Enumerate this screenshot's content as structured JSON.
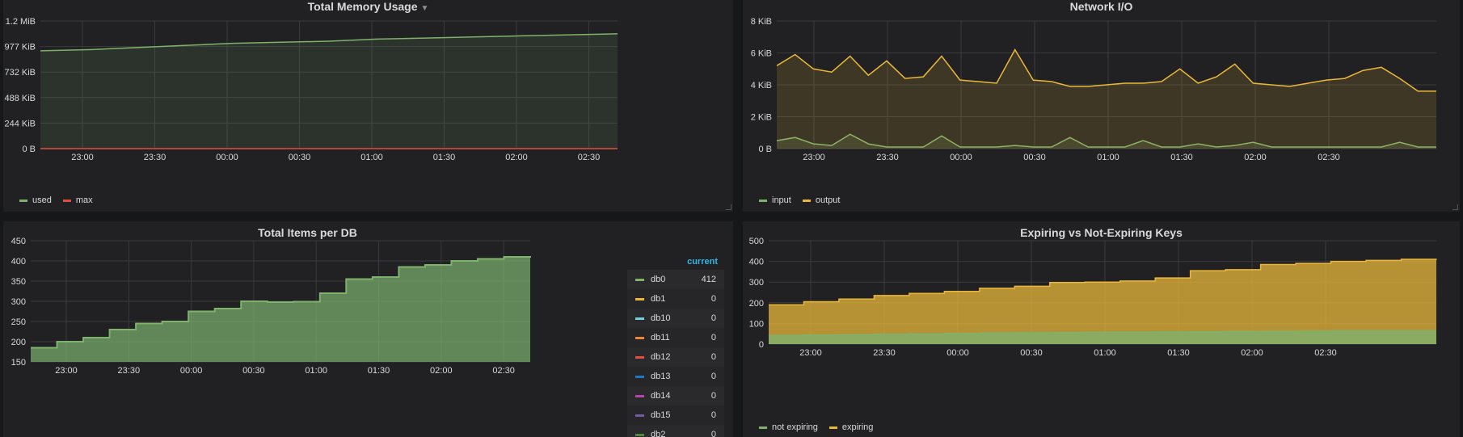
{
  "panels": {
    "memory": {
      "title": "Total Memory Usage",
      "legend": [
        {
          "label": "used",
          "color": "#7eb26d"
        },
        {
          "label": "max",
          "color": "#e24d42"
        }
      ]
    },
    "network": {
      "title": "Network I/O",
      "legend": [
        {
          "label": "input",
          "color": "#7eb26d"
        },
        {
          "label": "output",
          "color": "#eab839"
        }
      ]
    },
    "items": {
      "title": "Total Items per DB",
      "legend_header": "current",
      "legend": [
        {
          "label": "db0",
          "value": "412",
          "color": "#7eb26d"
        },
        {
          "label": "db1",
          "value": "0",
          "color": "#eab839"
        },
        {
          "label": "db10",
          "value": "0",
          "color": "#6ed0e0"
        },
        {
          "label": "db11",
          "value": "0",
          "color": "#ef843c"
        },
        {
          "label": "db12",
          "value": "0",
          "color": "#e24d42"
        },
        {
          "label": "db13",
          "value": "0",
          "color": "#1f78c1"
        },
        {
          "label": "db14",
          "value": "0",
          "color": "#ba43a9"
        },
        {
          "label": "db15",
          "value": "0",
          "color": "#705da0"
        },
        {
          "label": "db2",
          "value": "0",
          "color": "#508642"
        }
      ]
    },
    "expiring": {
      "title": "Expiring vs Not-Expiring Keys",
      "legend": [
        {
          "label": "not expiring",
          "color": "#7eb26d"
        },
        {
          "label": "expiring",
          "color": "#eab839"
        }
      ]
    }
  },
  "chart_data": [
    {
      "type": "line",
      "title": "Total Memory Usage",
      "x_ticks": [
        "23:00",
        "23:30",
        "00:00",
        "00:30",
        "01:00",
        "01:30",
        "02:00",
        "02:30"
      ],
      "y_ticks": [
        "0 B",
        "244 KiB",
        "488 KiB",
        "732 KiB",
        "977 KiB",
        "1.2 MiB"
      ],
      "ylim": [
        0,
        1.2
      ],
      "y_unit": "MiB",
      "series": [
        {
          "name": "used",
          "values": [
            0.92,
            0.93,
            0.95,
            0.97,
            0.99,
            1.0,
            1.01,
            1.03,
            1.04,
            1.05,
            1.06,
            1.07,
            1.08
          ]
        },
        {
          "name": "max",
          "values": [
            0,
            0,
            0,
            0,
            0,
            0,
            0,
            0,
            0,
            0,
            0,
            0,
            0
          ]
        }
      ]
    },
    {
      "type": "area",
      "title": "Network I/O",
      "x_ticks": [
        "23:00",
        "23:30",
        "00:00",
        "00:30",
        "01:00",
        "01:30",
        "02:00",
        "02:30"
      ],
      "y_ticks": [
        "0 B",
        "2 KiB",
        "4 KiB",
        "6 KiB",
        "8 KiB"
      ],
      "ylim": [
        0,
        8
      ],
      "y_unit": "KiB",
      "series": [
        {
          "name": "input",
          "values": [
            0.5,
            0.7,
            0.3,
            0.2,
            0.9,
            0.3,
            0.1,
            0.1,
            0.1,
            0.8,
            0.1,
            0.1,
            0.1,
            0.2,
            0.1,
            0.1,
            0.7,
            0.1,
            0.1,
            0.1,
            0.5,
            0.1,
            0.1,
            0.3,
            0.1,
            0.2,
            0.4,
            0.1,
            0.1,
            0.1,
            0.1,
            0.1,
            0.1,
            0.1,
            0.4,
            0.1,
            0.1
          ]
        },
        {
          "name": "output",
          "values": [
            5.2,
            5.9,
            5.0,
            4.8,
            5.8,
            4.6,
            5.5,
            4.4,
            4.5,
            5.8,
            4.3,
            4.2,
            4.1,
            6.2,
            4.3,
            4.2,
            3.9,
            3.9,
            4.0,
            4.1,
            4.1,
            4.2,
            5.0,
            4.1,
            4.5,
            5.3,
            4.1,
            4.0,
            3.9,
            4.1,
            4.3,
            4.4,
            4.9,
            5.1,
            4.4,
            3.6,
            3.6
          ]
        }
      ]
    },
    {
      "type": "area",
      "title": "Total Items per DB",
      "x_ticks": [
        "23:00",
        "23:30",
        "00:00",
        "00:30",
        "01:00",
        "01:30",
        "02:00",
        "02:30"
      ],
      "y_ticks": [
        "150",
        "200",
        "250",
        "300",
        "350",
        "400",
        "450"
      ],
      "ylim": [
        150,
        450
      ],
      "series": [
        {
          "name": "db0",
          "values": [
            185,
            200,
            210,
            230,
            245,
            250,
            275,
            282,
            300,
            298,
            299,
            320,
            355,
            360,
            385,
            390,
            400,
            405,
            410,
            412
          ]
        }
      ]
    },
    {
      "type": "area",
      "title": "Expiring vs Not-Expiring Keys",
      "x_ticks": [
        "23:00",
        "23:30",
        "00:00",
        "00:30",
        "01:00",
        "01:30",
        "02:00",
        "02:30"
      ],
      "y_ticks": [
        "0",
        "100",
        "200",
        "300",
        "400",
        "500"
      ],
      "ylim": [
        0,
        500
      ],
      "series": [
        {
          "name": "not expiring",
          "values": [
            42,
            44,
            46,
            48,
            50,
            52,
            54,
            55,
            56,
            57,
            58,
            59,
            60,
            61,
            62,
            63,
            64,
            64,
            64,
            64
          ]
        },
        {
          "name": "expiring",
          "values": [
            190,
            205,
            218,
            235,
            245,
            255,
            270,
            280,
            298,
            300,
            305,
            320,
            355,
            360,
            385,
            390,
            400,
            405,
            410,
            412
          ]
        }
      ]
    }
  ]
}
